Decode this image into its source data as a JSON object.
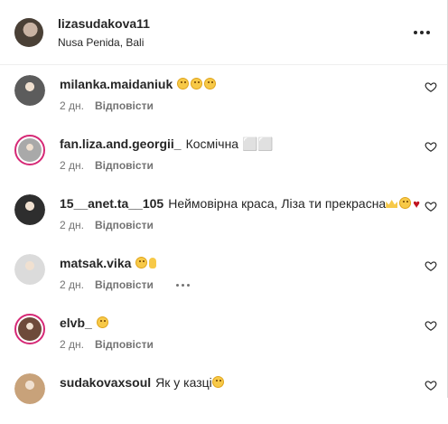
{
  "post": {
    "username": "lizasudakova11",
    "location": "Nusa Penida, Bali"
  },
  "comments": [
    {
      "username": "milanka.maidaniuk",
      "text": "",
      "emoji": [
        "smile",
        "smile",
        "smile"
      ],
      "time": "2 дн.",
      "reply_label": "Відповісти",
      "ring": false,
      "avatar_color": "#5c5c5c",
      "show_more": false
    },
    {
      "username": "fan.liza.and.georgii_",
      "text": "Космічна ⬜⬜",
      "emoji": [],
      "time": "2 дн.",
      "reply_label": "Відповісти",
      "ring": true,
      "avatar_color": "#a9a9a9",
      "show_more": false
    },
    {
      "username": "15__anet.ta__105",
      "text": "Неймовірна краса, Ліза ти прекрасна",
      "emoji": [
        "crown",
        "smile",
        "heart"
      ],
      "time": "2 дн.",
      "reply_label": "Відповісти",
      "ring": false,
      "avatar_color": "#2e2e2e",
      "show_more": false
    },
    {
      "username": "matsak.vika",
      "text": "",
      "emoji": [
        "smile",
        "hand"
      ],
      "time": "2 дн.",
      "reply_label": "Відповісти",
      "ring": false,
      "avatar_color": "#dbdbdb",
      "show_more": true
    },
    {
      "username": "elvb_",
      "text": "",
      "emoji": [
        "smile"
      ],
      "time": "2 дн.",
      "reply_label": "Відповісти",
      "ring": true,
      "avatar_color": "#6e4a3a",
      "show_more": false
    },
    {
      "username": "sudakovaxsoul",
      "text": "Як у казці",
      "emoji": [
        "smile"
      ],
      "time": "",
      "reply_label": "",
      "ring": false,
      "avatar_color": "#c8a27a",
      "show_more": false
    }
  ],
  "colors": {
    "ring": "#d62976",
    "meta": "#737373",
    "text": "#262626"
  }
}
